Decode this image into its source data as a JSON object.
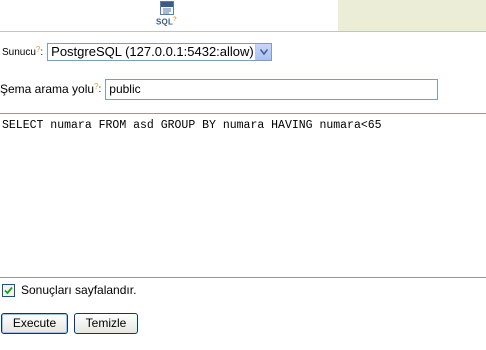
{
  "tab": {
    "label": "SQL",
    "help_mark": "?"
  },
  "server": {
    "label": "Sunucu",
    "help_mark": "?",
    "colon": ":",
    "selected": "PostgreSQL (127.0.0.1:5432:allow)"
  },
  "schema": {
    "label": "Şema arama yolu",
    "help_mark": "?",
    "colon": ":",
    "value": "public"
  },
  "query": {
    "text": "SELECT numara FROM asd GROUP BY numara HAVING numara<65"
  },
  "paginate": {
    "label": "Sonuçları sayfalandır.",
    "checked": true
  },
  "buttons": {
    "execute": "Execute",
    "clear": "Temizle"
  }
}
